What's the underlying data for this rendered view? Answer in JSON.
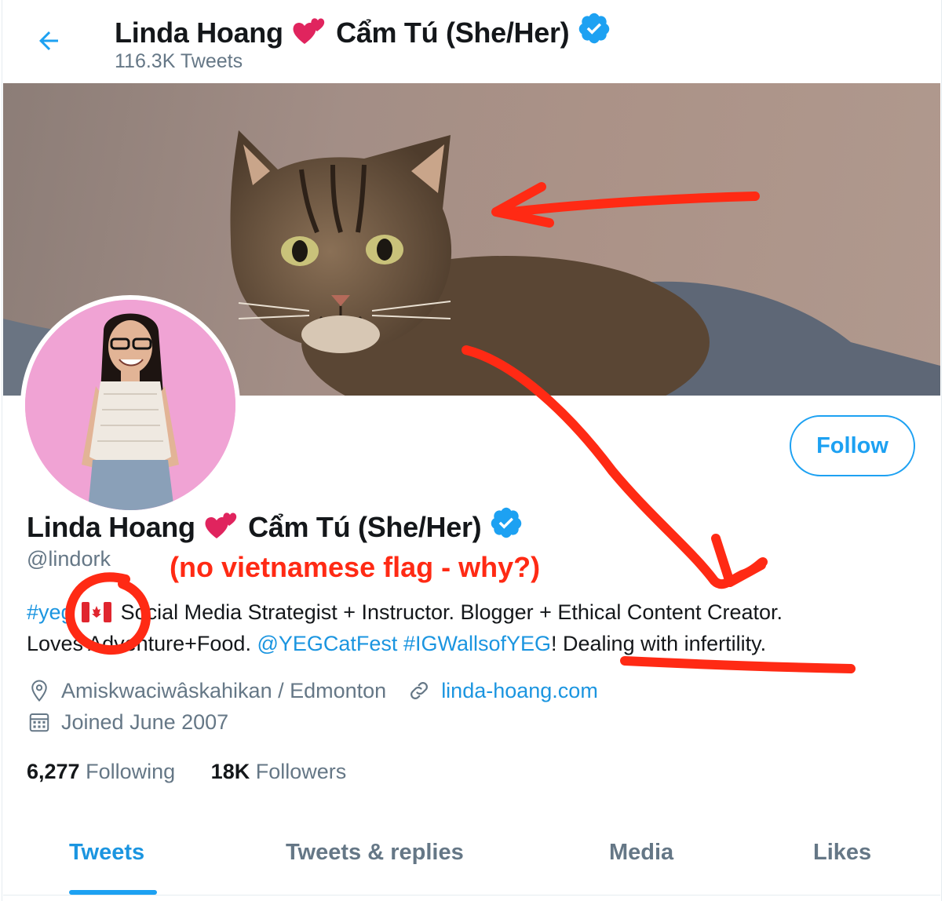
{
  "header": {
    "name_part1": "Linda Hoang",
    "name_part2": "Cẩm Tú (She/Her)",
    "tweet_count": "116.3K Tweets"
  },
  "profile": {
    "name_part1": "Linda Hoang",
    "name_part2": "Cẩm Tú (She/Her)",
    "handle": "@lindork",
    "follow_label": "Follow",
    "bio": {
      "hashtag_yeg": "#yeg",
      "text1": " Social Media Strategist + Instructor. Blogger + Ethical Content Creator.",
      "text2": "Loves Adventure+Food. ",
      "mention": "@YEGCatFest",
      "hashtag_walls": "#IGWallsofYEG",
      "text3": "! ",
      "text4": "Dealing with infertility."
    },
    "location": "Amiskwaciwâskahikan / Edmonton",
    "website": "linda-hoang.com",
    "joined": "Joined June 2007",
    "following_count": "6,277",
    "following_label": "Following",
    "followers_count": "18K",
    "followers_label": "Followers"
  },
  "tabs": [
    {
      "label": "Tweets",
      "active": true
    },
    {
      "label": "Tweets & replies",
      "active": false
    },
    {
      "label": "Media",
      "active": false
    },
    {
      "label": "Likes",
      "active": false
    }
  ],
  "annotation": {
    "text": "(no vietnamese flag - why?)",
    "color": "#ff2a14"
  },
  "colors": {
    "accent": "#1da1f2",
    "link": "#1b95e0",
    "secondary_text": "#657786"
  }
}
